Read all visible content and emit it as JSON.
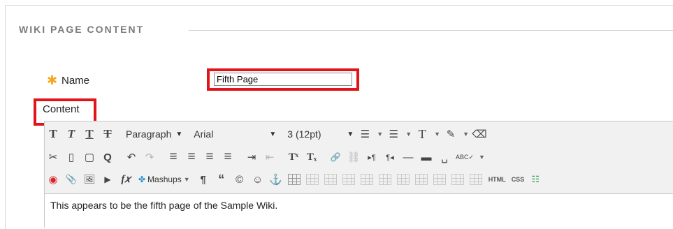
{
  "section": {
    "title": "WIKI PAGE CONTENT"
  },
  "name_field": {
    "required_marker": "✱",
    "label": "Name",
    "value": "Fifth Page"
  },
  "content_field": {
    "label": "Content"
  },
  "toolbar": {
    "row1": {
      "bold": "T",
      "italic": "T",
      "underline": "T",
      "strikethrough": "T",
      "format_select": "Paragraph",
      "font_select": "Arial",
      "size_select": "3 (12pt)",
      "bullet_list": "☰",
      "numbered_list": "☰",
      "text_color": "T",
      "highlight": "✎",
      "clear_format": "⌫"
    },
    "row2": {
      "cut": "✂",
      "copy": "▯",
      "paste": "▢",
      "find": "Q",
      "undo": "↶",
      "redo": "↷",
      "align_left": "≡",
      "align_center": "≡",
      "align_right": "≡",
      "justify": "≡",
      "indent": "⇥",
      "outdent": "⇤",
      "superscript": "Tˣ",
      "subscript": "Tₓ",
      "link": "🔗",
      "unlink": "⛓",
      "ltr": "▸¶",
      "rtl": "¶◂",
      "hr": "—",
      "hr_thick": "▬",
      "nbsp": "␣",
      "spellcheck": "ABC✓"
    },
    "row3": {
      "record": "◉",
      "attach": "📎",
      "image": "🖼",
      "media": "▶",
      "math": "f𝑥",
      "mashups": "Mashups",
      "paragraph_mark": "¶",
      "quote": "“",
      "copyright": "©",
      "emoji": "☺",
      "anchor": "⚓",
      "html_label": "HTML",
      "css_label": "CSS"
    }
  },
  "editor": {
    "body_text": "This appears to be the fifth page of the Sample Wiki."
  },
  "colors": {
    "highlight_red": "#e2141b",
    "required_orange": "#f5a623",
    "section_gray": "#7a7a7a"
  }
}
